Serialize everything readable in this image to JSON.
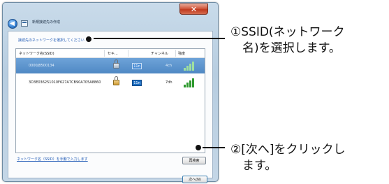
{
  "window": {
    "title": "新規接続先の作成",
    "close_glyph": "✕",
    "back_glyph": "◀"
  },
  "instruction": "接続先のネットワークを選択してください",
  "list": {
    "columns": [
      "ネットワーク名(SSID)",
      "セキ...",
      "チャンネル",
      "強度"
    ],
    "rows": [
      {
        "ssid": "0000JB500134",
        "badge": "11n",
        "channel": "4ch",
        "selected": true,
        "signal_bars": 4
      },
      {
        "ssid": "3D3E036251010F627A7CB90A705A8860",
        "badge": "11n",
        "channel": "7dh",
        "selected": false,
        "signal_bars": 4
      }
    ]
  },
  "manual_link": "ネットワーク名（SSID）を手動で入力します",
  "refresh_button": "再検索",
  "next_button": "次へ(N)",
  "callouts": {
    "c1": "①SSID(ネットワーク\n　名)を選択します。",
    "c2": "②[次へ]をクリックし\n　ます。"
  },
  "colors": {
    "selection": "#5b93cc",
    "link": "#1e59b5",
    "signal": "#2f9a2f"
  }
}
